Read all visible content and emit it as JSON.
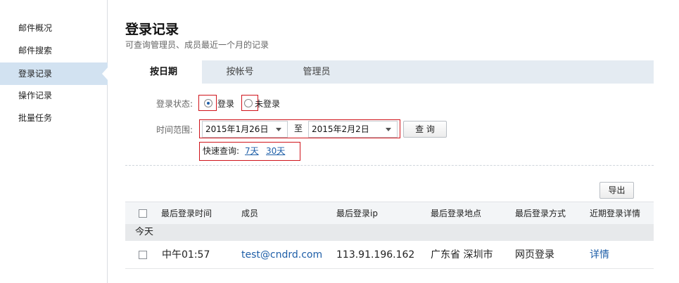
{
  "sidebar": {
    "items": [
      {
        "label": "邮件概况",
        "active": false
      },
      {
        "label": "邮件搜索",
        "active": false
      },
      {
        "label": "登录记录",
        "active": true
      },
      {
        "label": "操作记录",
        "active": false
      },
      {
        "label": "批量任务",
        "active": false
      }
    ]
  },
  "header": {
    "title": "登录记录",
    "subtitle": "可查询管理员、成员最近一个月的记录"
  },
  "tabs": [
    {
      "label": "按日期",
      "active": true
    },
    {
      "label": "按帐号",
      "active": false
    },
    {
      "label": "管理员",
      "active": false
    }
  ],
  "filters": {
    "status_label": "登录状态:",
    "status_options": [
      {
        "label": "登录",
        "selected": true
      },
      {
        "label": "未登录",
        "selected": false
      }
    ],
    "range_label": "时间范围:",
    "date_from": "2015年1月26日",
    "to_label": "至",
    "date_to": "2015年2月2日",
    "query_button": "查 询",
    "quick_label": "快速查询:",
    "quick_links": [
      "7天",
      "30天"
    ]
  },
  "export_button": "导出",
  "table": {
    "columns": [
      "最后登录时间",
      "成员",
      "最后登录ip",
      "最后登录地点",
      "最后登录方式",
      "近期登录详情"
    ],
    "group_label": "今天",
    "rows": [
      {
        "time": "中午01:57",
        "member": "test@cndrd.com",
        "ip": "113.91.196.162",
        "location": "广东省 深圳市",
        "method": "网页登录",
        "detail": "详情"
      }
    ]
  },
  "colors": {
    "accent": "#1f5fa8",
    "highlight_box": "#d0141b",
    "sidebar_active": "#d2e2f1",
    "tabbar": "#e4ebf2"
  }
}
